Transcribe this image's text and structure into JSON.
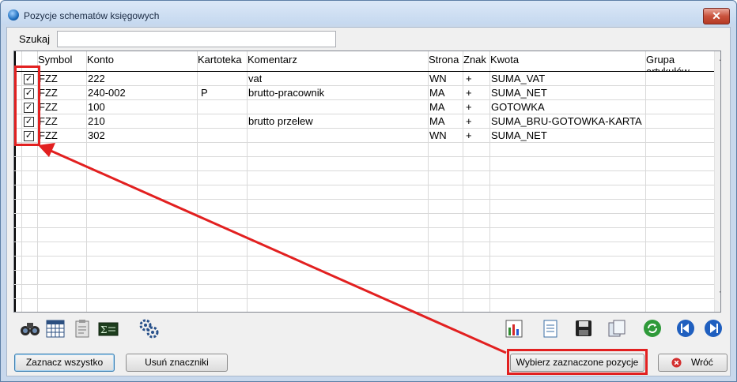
{
  "window": {
    "title": "Pozycje schematów księgowych",
    "close_glyph": "✕"
  },
  "search": {
    "label": "Szukaj",
    "value": "",
    "placeholder": ""
  },
  "grid": {
    "columns": [
      "Symbol",
      "Konto",
      "Kartoteka",
      "Komentarz",
      "Strona",
      "Znak",
      "Kwota",
      "Grupa artykułów"
    ],
    "rows": [
      {
        "checked": true,
        "symbol": "FZZ",
        "konto": "222",
        "kartoteka": "",
        "komentarz": "vat",
        "strona": "WN",
        "znak": "+",
        "kwota": "SUMA_VAT",
        "grupa": ""
      },
      {
        "checked": true,
        "symbol": "FZZ",
        "konto": "240-002",
        "kartoteka": "P",
        "komentarz": "brutto-pracownik",
        "strona": "MA",
        "znak": "+",
        "kwota": "SUMA_NET",
        "grupa": ""
      },
      {
        "checked": true,
        "symbol": "FZZ",
        "konto": "100",
        "kartoteka": "",
        "komentarz": "",
        "strona": "MA",
        "znak": "+",
        "kwota": "GOTOWKA",
        "grupa": ""
      },
      {
        "checked": true,
        "symbol": "FZZ",
        "konto": "210",
        "kartoteka": "",
        "komentarz": "brutto przelew",
        "strona": "MA",
        "znak": "+",
        "kwota": "SUMA_BRU-GOTOWKA-KARTA",
        "grupa": ""
      },
      {
        "checked": true,
        "symbol": "FZZ",
        "konto": "302",
        "kartoteka": "",
        "komentarz": "",
        "strona": "WN",
        "znak": "+",
        "kwota": "SUMA_NET",
        "grupa": ""
      }
    ],
    "check_glyph": "✓"
  },
  "toolbar_left": [
    "binoculars-icon",
    "calendar-grid-icon",
    "clipboard-icon",
    "formula-icon",
    "gears-icon"
  ],
  "toolbar_right": [
    "bar-chart-icon",
    "document-icon",
    "floppy-disk-icon",
    "copy-icon",
    "refresh-icon",
    "previous-icon",
    "next-icon"
  ],
  "buttons": {
    "select_all": "Zaznacz wszystko",
    "remove_marks": "Usuń znaczniki",
    "choose_selected": "Wybierz zaznaczone pozycje",
    "back": "Wróć"
  },
  "colors": {
    "highlight": "#e22020",
    "arrow": "#e22020"
  }
}
